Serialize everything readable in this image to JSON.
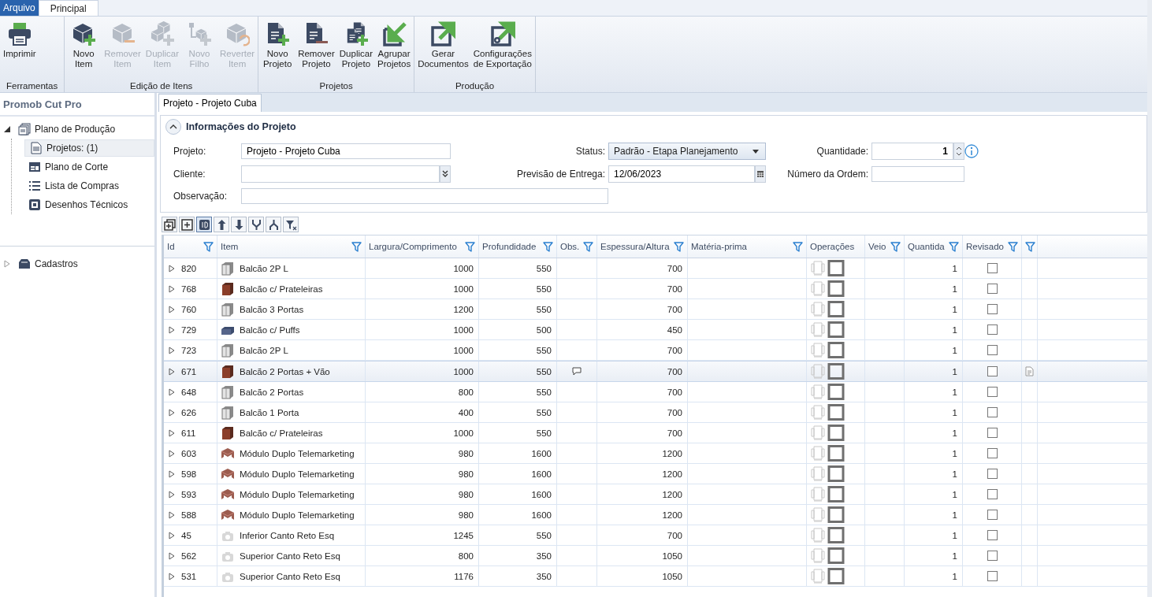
{
  "ribbon": {
    "tabs": [
      {
        "label": "Arquivo",
        "selected": false,
        "kind": "file"
      },
      {
        "label": "Principal",
        "selected": true,
        "kind": "normal"
      }
    ],
    "groups": [
      {
        "label": "Ferramentas",
        "buttons": [
          {
            "kind": "printer",
            "label": "Imprimir",
            "disabled": false
          }
        ]
      },
      {
        "label": "Edição de Itens",
        "buttons": [
          {
            "kind": "cube-plus",
            "label": "Novo\nItem",
            "disabled": false
          },
          {
            "kind": "cube-minus",
            "label": "Remover\nItem",
            "disabled": true
          },
          {
            "kind": "cubes-plus",
            "label": "Duplicar\nItem",
            "disabled": true
          },
          {
            "kind": "tree-plus",
            "label": "Novo\nFilho",
            "disabled": true
          },
          {
            "kind": "cube-undo",
            "label": "Reverter\nItem",
            "disabled": true
          }
        ]
      },
      {
        "label": "Projetos",
        "buttons": [
          {
            "kind": "doc-plus",
            "label": "Novo\nProjeto",
            "disabled": false
          },
          {
            "kind": "doc-minus",
            "label": "Remover\nProjeto",
            "disabled": false
          },
          {
            "kind": "docs-plus",
            "label": "Duplicar\nProjeto",
            "disabled": false
          },
          {
            "kind": "arrow-in",
            "label": "Agrupar\nProjetos",
            "disabled": false
          }
        ]
      },
      {
        "label": "Produção",
        "buttons": [
          {
            "kind": "arrow-out",
            "label": "Gerar\nDocumentos",
            "disabled": false
          },
          {
            "kind": "arrow-out-gear",
            "label": "Configurações\nde Exportação",
            "disabled": false
          }
        ]
      }
    ]
  },
  "sidebar": {
    "title": "Promob Cut Pro",
    "items": [
      {
        "label": "Plano de Produção",
        "kind": "stack",
        "expanded": true,
        "selected": false,
        "children": [
          {
            "label": "Projetos: (1)",
            "kind": "doc",
            "selected": true
          },
          {
            "label": "Plano de Corte",
            "kind": "layout",
            "selected": false
          },
          {
            "label": "Lista de Compras",
            "kind": "list",
            "selected": false
          },
          {
            "label": "Desenhos Técnicos",
            "kind": "drawing",
            "selected": false
          }
        ]
      },
      {
        "label": "Cadastros",
        "kind": "box",
        "expanded": false,
        "selected": false
      }
    ]
  },
  "document_tab": {
    "label": "Projeto - Projeto Cuba",
    "selected": true
  },
  "project_info": {
    "title": "Informações do Projeto",
    "expanded": true,
    "projeto": {
      "label": "Projeto:",
      "value": "Projeto - Projeto Cuba"
    },
    "cliente": {
      "label": "Cliente:"
    },
    "observacao": {
      "label": "Observação:"
    },
    "status": {
      "label": "Status:",
      "value": "Padrão - Etapa Planejamento"
    },
    "previsao": {
      "label": "Previsão de Entrega:",
      "value": "12/06/2023"
    },
    "quantidade": {
      "label": "Quantidade:",
      "value": "1"
    },
    "numero_ordem": {
      "label": "Número da Ordem:"
    }
  },
  "grid_toolbar": [
    {
      "kind": "collapse-all",
      "selected": false
    },
    {
      "kind": "expand-all",
      "selected": false
    },
    {
      "kind": "id",
      "selected": true
    },
    {
      "kind": "up",
      "selected": false
    },
    {
      "kind": "down",
      "selected": false
    },
    {
      "kind": "merge",
      "selected": false
    },
    {
      "kind": "split",
      "selected": false
    },
    {
      "kind": "clear-filter",
      "selected": false
    }
  ],
  "table": {
    "columns": [
      {
        "label": "Id",
        "filter": true
      },
      {
        "label": "Item",
        "filter": true
      },
      {
        "label": "Largura/Comprimento",
        "filter": true
      },
      {
        "label": "Profundidade",
        "filter": true
      },
      {
        "label": "Obs.",
        "filter": true
      },
      {
        "label": "Espessura/Altura",
        "filter": true
      },
      {
        "label": "Matéria-prima",
        "filter": true
      },
      {
        "label": "Operações",
        "filter": false
      },
      {
        "label": "Veio",
        "filter": true
      },
      {
        "label": "Quantida",
        "filter": true
      },
      {
        "label": "Revisado",
        "filter": true
      },
      {
        "filter": true
      }
    ],
    "rows": [
      {
        "id": "820",
        "item": "Balcão 2P L",
        "kind": "cabinet-light",
        "largura": "1000",
        "profundidade": "550",
        "espessura": "700",
        "quantidade": "1",
        "note": false,
        "revisado": false,
        "doc": false,
        "selected": false
      },
      {
        "id": "768",
        "item": "Balcão c/ Prateleiras",
        "kind": "cabinet-brown",
        "largura": "1000",
        "profundidade": "550",
        "espessura": "700",
        "quantidade": "1",
        "note": false,
        "revisado": false,
        "doc": false,
        "selected": false
      },
      {
        "id": "760",
        "item": "Balcão 3 Portas",
        "kind": "cabinet-light",
        "largura": "1200",
        "profundidade": "550",
        "espessura": "700",
        "quantidade": "1",
        "note": false,
        "revisado": false,
        "doc": false,
        "selected": false
      },
      {
        "id": "729",
        "item": "Balcão c/ Puffs",
        "kind": "cabinet-blue",
        "largura": "1000",
        "profundidade": "500",
        "espessura": "450",
        "quantidade": "1",
        "note": false,
        "revisado": false,
        "doc": false,
        "selected": false
      },
      {
        "id": "723",
        "item": "Balcão 2P L",
        "kind": "cabinet-light",
        "largura": "1000",
        "profundidade": "550",
        "espessura": "700",
        "quantidade": "1",
        "note": false,
        "revisado": false,
        "doc": false,
        "selected": false
      },
      {
        "id": "671",
        "item": "Balcão 2 Portas + Vão",
        "kind": "cabinet-brown",
        "largura": "1000",
        "profundidade": "550",
        "espessura": "700",
        "quantidade": "1",
        "note": true,
        "revisado": false,
        "doc": true,
        "selected": true
      },
      {
        "id": "648",
        "item": "Balcão 2 Portas",
        "kind": "cabinet-light",
        "largura": "800",
        "profundidade": "550",
        "espessura": "700",
        "quantidade": "1",
        "note": false,
        "revisado": false,
        "doc": false,
        "selected": false
      },
      {
        "id": "626",
        "item": "Balcão 1 Porta",
        "kind": "cabinet-light",
        "largura": "400",
        "profundidade": "550",
        "espessura": "700",
        "quantidade": "1",
        "note": false,
        "revisado": false,
        "doc": false,
        "selected": false
      },
      {
        "id": "611",
        "item": "Balcão c/ Prateleiras",
        "kind": "cabinet-brown",
        "largura": "1000",
        "profundidade": "550",
        "espessura": "700",
        "quantidade": "1",
        "note": false,
        "revisado": false,
        "doc": false,
        "selected": false
      },
      {
        "id": "603",
        "item": "Módulo Duplo Telemarketing",
        "kind": "desk",
        "largura": "980",
        "profundidade": "1600",
        "espessura": "1200",
        "quantidade": "1",
        "note": false,
        "revisado": false,
        "doc": false,
        "selected": false
      },
      {
        "id": "598",
        "item": "Módulo Duplo Telemarketing",
        "kind": "desk",
        "largura": "980",
        "profundidade": "1600",
        "espessura": "1200",
        "quantidade": "1",
        "note": false,
        "revisado": false,
        "doc": false,
        "selected": false
      },
      {
        "id": "593",
        "item": "Módulo Duplo Telemarketing",
        "kind": "desk",
        "largura": "980",
        "profundidade": "1600",
        "espessura": "1200",
        "quantidade": "1",
        "note": false,
        "revisado": false,
        "doc": false,
        "selected": false
      },
      {
        "id": "588",
        "item": "Módulo Duplo Telemarketing",
        "kind": "desk",
        "largura": "980",
        "profundidade": "1600",
        "espessura": "1200",
        "quantidade": "1",
        "note": false,
        "revisado": false,
        "doc": false,
        "selected": false
      },
      {
        "id": "45",
        "item": "Inferior Canto Reto Esq",
        "kind": "camera",
        "largura": "1245",
        "profundidade": "550",
        "espessura": "700",
        "quantidade": "1",
        "note": false,
        "revisado": false,
        "doc": false,
        "selected": false
      },
      {
        "id": "562",
        "item": "Superior Canto Reto Esq",
        "kind": "camera",
        "largura": "800",
        "profundidade": "350",
        "espessura": "1050",
        "quantidade": "1",
        "note": false,
        "revisado": false,
        "doc": false,
        "selected": false
      },
      {
        "id": "531",
        "item": "Superior Canto Reto Esq",
        "kind": "camera",
        "largura": "1176",
        "profundidade": "350",
        "espessura": "1050",
        "quantidade": "1",
        "note": false,
        "revisado": false,
        "doc": false,
        "selected": false
      }
    ]
  }
}
